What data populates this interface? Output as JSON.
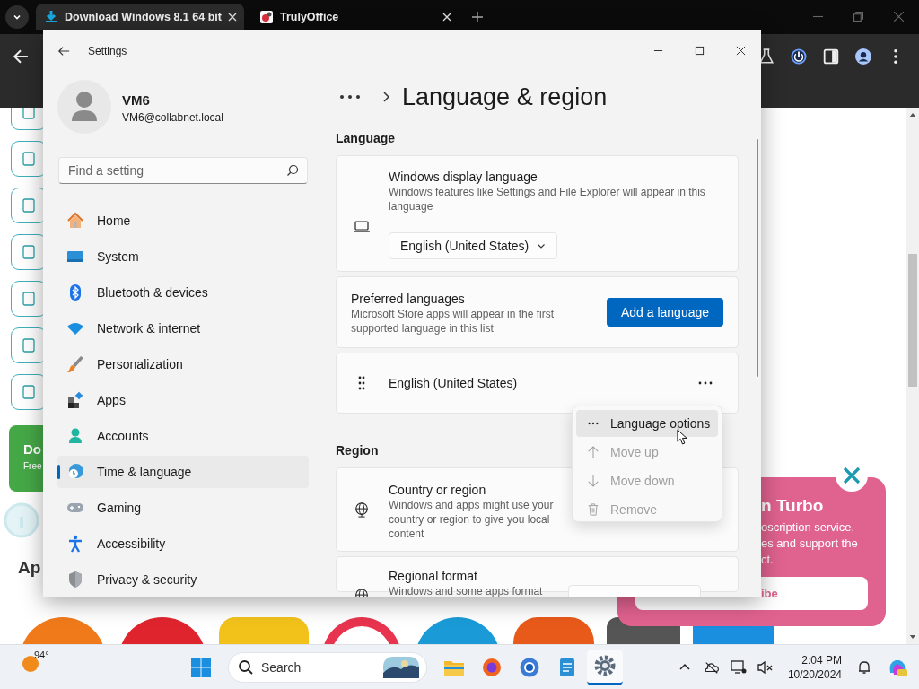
{
  "browser": {
    "tabs": [
      {
        "title": "Download Windows 8.1 64 bit",
        "selected": true
      },
      {
        "title": "TrulyOffice",
        "selected": false
      }
    ],
    "page": {
      "promo_button": {
        "title": "Do",
        "subtitle": "Free"
      },
      "heading": "Ap",
      "popup": {
        "title": "n Turbo",
        "lines": [
          "oscription service,",
          "es and support the",
          "ct."
        ],
        "button": "ibe"
      }
    }
  },
  "settings": {
    "title": "Settings",
    "user": {
      "name": "VM6",
      "email": "VM6@collabnet.local"
    },
    "search": {
      "placeholder": "Find a setting"
    },
    "nav": [
      {
        "label": "Home",
        "selected": false
      },
      {
        "label": "System",
        "selected": false
      },
      {
        "label": "Bluetooth & devices",
        "selected": false
      },
      {
        "label": "Network & internet",
        "selected": false
      },
      {
        "label": "Personalization",
        "selected": false
      },
      {
        "label": "Apps",
        "selected": false
      },
      {
        "label": "Accounts",
        "selected": false
      },
      {
        "label": "Time & language",
        "selected": true
      },
      {
        "label": "Gaming",
        "selected": false
      },
      {
        "label": "Accessibility",
        "selected": false
      },
      {
        "label": "Privacy & security",
        "selected": false
      }
    ],
    "page_title": "Language & region",
    "sections": [
      {
        "heading": "Language",
        "cards": [
          {
            "kind": "dropdown",
            "title": "Windows display language",
            "description": "Windows features like Settings and File Explorer will appear in this language",
            "value": "English (United States)"
          },
          {
            "kind": "button",
            "title": "Preferred languages",
            "description": "Microsoft Store apps will appear in the first supported language in this list",
            "button": "Add a language"
          },
          {
            "kind": "language",
            "label": "English (United States)"
          }
        ]
      },
      {
        "heading": "Region",
        "cards": [
          {
            "kind": "info",
            "title": "Country or region",
            "description": "Windows and apps might use your country or region to give you local content"
          },
          {
            "kind": "format",
            "title": "Regional format",
            "description": "Windows and some apps format"
          }
        ]
      }
    ],
    "context_menu": [
      {
        "kind": "options",
        "label": "Language options",
        "disabled": false,
        "highlighted": true
      },
      {
        "kind": "up",
        "label": "Move up",
        "disabled": true,
        "highlighted": false
      },
      {
        "kind": "down",
        "label": "Move down",
        "disabled": true,
        "highlighted": false
      },
      {
        "kind": "remove",
        "label": "Remove",
        "disabled": true,
        "highlighted": false
      }
    ]
  },
  "taskbar": {
    "weather": "94°",
    "search": "Search",
    "time": "2:04 PM",
    "date": "10/20/2024"
  }
}
